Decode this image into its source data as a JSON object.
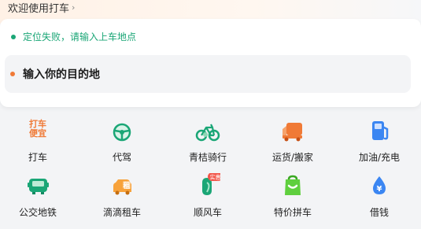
{
  "header": {
    "welcome": "欢迎使用打车",
    "chevron": "›"
  },
  "location": {
    "status": "定位失败，请输入上车地点",
    "destination_placeholder": "输入你的目的地"
  },
  "icon_texts": {
    "taxi_top": "打车",
    "taxi_bottom": "便宜",
    "rent": "租",
    "badge": "实惠",
    "yen": "¥"
  },
  "services": [
    {
      "label": "打车",
      "icon": "taxi-cheap-icon"
    },
    {
      "label": "代驾",
      "icon": "steering-wheel-icon"
    },
    {
      "label": "青桔骑行",
      "icon": "bike-icon"
    },
    {
      "label": "运货/搬家",
      "icon": "truck-icon"
    },
    {
      "label": "加油/充电",
      "icon": "fuel-pump-icon"
    },
    {
      "label": "公交地铁",
      "icon": "bus-icon"
    },
    {
      "label": "滴滴租车",
      "icon": "rental-car-icon"
    },
    {
      "label": "顺风车",
      "icon": "hitch-leaf-icon"
    },
    {
      "label": "特价拼车",
      "icon": "bag-icon"
    },
    {
      "label": "借钱",
      "icon": "money-drop-icon"
    }
  ],
  "colors": {
    "green": "#1aa676",
    "orange": "#f07a36",
    "blue": "#3b86f2"
  }
}
